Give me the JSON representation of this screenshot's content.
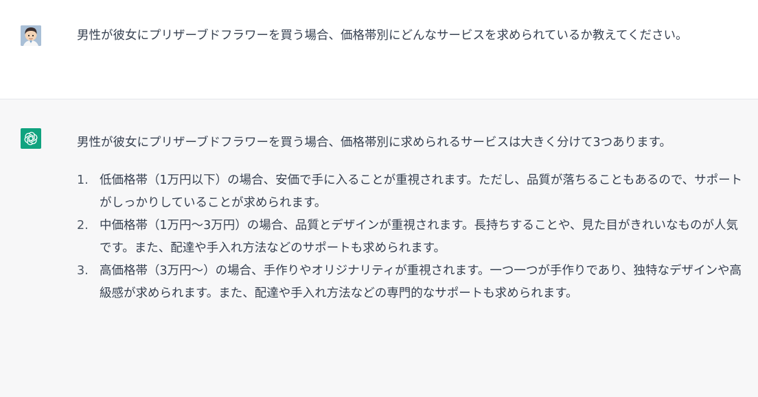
{
  "conversation": {
    "user": {
      "avatar_icon": "user-avatar-icon",
      "text": "男性が彼女にプリザーブドフラワーを買う場合、価格帯別にどんなサービスを求められているか教えてください。"
    },
    "assistant": {
      "avatar_icon": "openai-logo-icon",
      "intro": "男性が彼女にプリザーブドフラワーを買う場合、価格帯別に求められるサービスは大きく分けて3つあります。",
      "items": [
        {
          "number": "1.",
          "text": "低価格帯（1万円以下）の場合、安価で手に入ることが重視されます。ただし、品質が落ちることもあるので、サポートがしっかりしていることが求められます。"
        },
        {
          "number": "2.",
          "text": "中価格帯（1万円〜3万円）の場合、品質とデザインが重視されます。長持ちすることや、見た目がきれいなものが人気です。また、配達や手入れ方法などのサポートも求められます。"
        },
        {
          "number": "3.",
          "text": "高価格帯（3万円〜）の場合、手作りやオリジナリティが重視されます。一つ一つが手作りであり、独特なデザインや高級感が求められます。また、配達や手入れ方法などの専門的なサポートも求められます。"
        }
      ]
    }
  },
  "colors": {
    "assistant_background": "#f7f7f8",
    "assistant_avatar": "#10a37f",
    "text": "#374151",
    "divider": "#e5e7eb"
  }
}
